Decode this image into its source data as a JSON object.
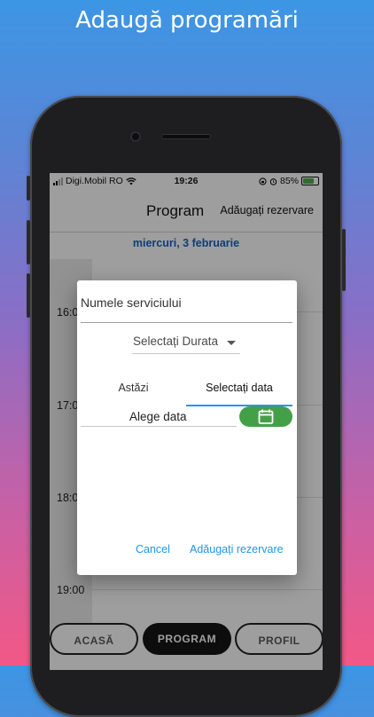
{
  "promo": {
    "title": "Adaugă programări"
  },
  "status_bar": {
    "carrier": "Digi.Mobil RO",
    "time": "19:26",
    "battery": "85%",
    "battery_level": 0.85
  },
  "app_bar": {
    "title": "Program",
    "action": "Adăugați rezervare"
  },
  "schedule": {
    "date": "miercuri, 3 februarie",
    "times": [
      "16:00",
      "17:00",
      "18:00",
      "19:00"
    ]
  },
  "bottom_nav": {
    "home": "ACASĂ",
    "program": "PROGRAM",
    "profile": "PROFIL"
  },
  "dialog": {
    "service_placeholder": "Numele serviciului",
    "duration_placeholder": "Selectați Durata",
    "tab_today": "Astăzi",
    "tab_select_date": "Selectați data",
    "date_placeholder": "Alege data",
    "cancel": "Cancel",
    "add": "Adăugați rezervare"
  },
  "colors": {
    "accent_blue": "#2196f3",
    "date_header_blue": "#1565c0",
    "calendar_green": "#43a047",
    "background_top": "#3c96e4",
    "background_bottom": "#f25886"
  },
  "icons": [
    "signal-icon",
    "wifi-icon",
    "lock-rotation-icon",
    "alarm-icon",
    "battery-icon",
    "calendar-icon",
    "dropdown-caret-icon"
  ]
}
